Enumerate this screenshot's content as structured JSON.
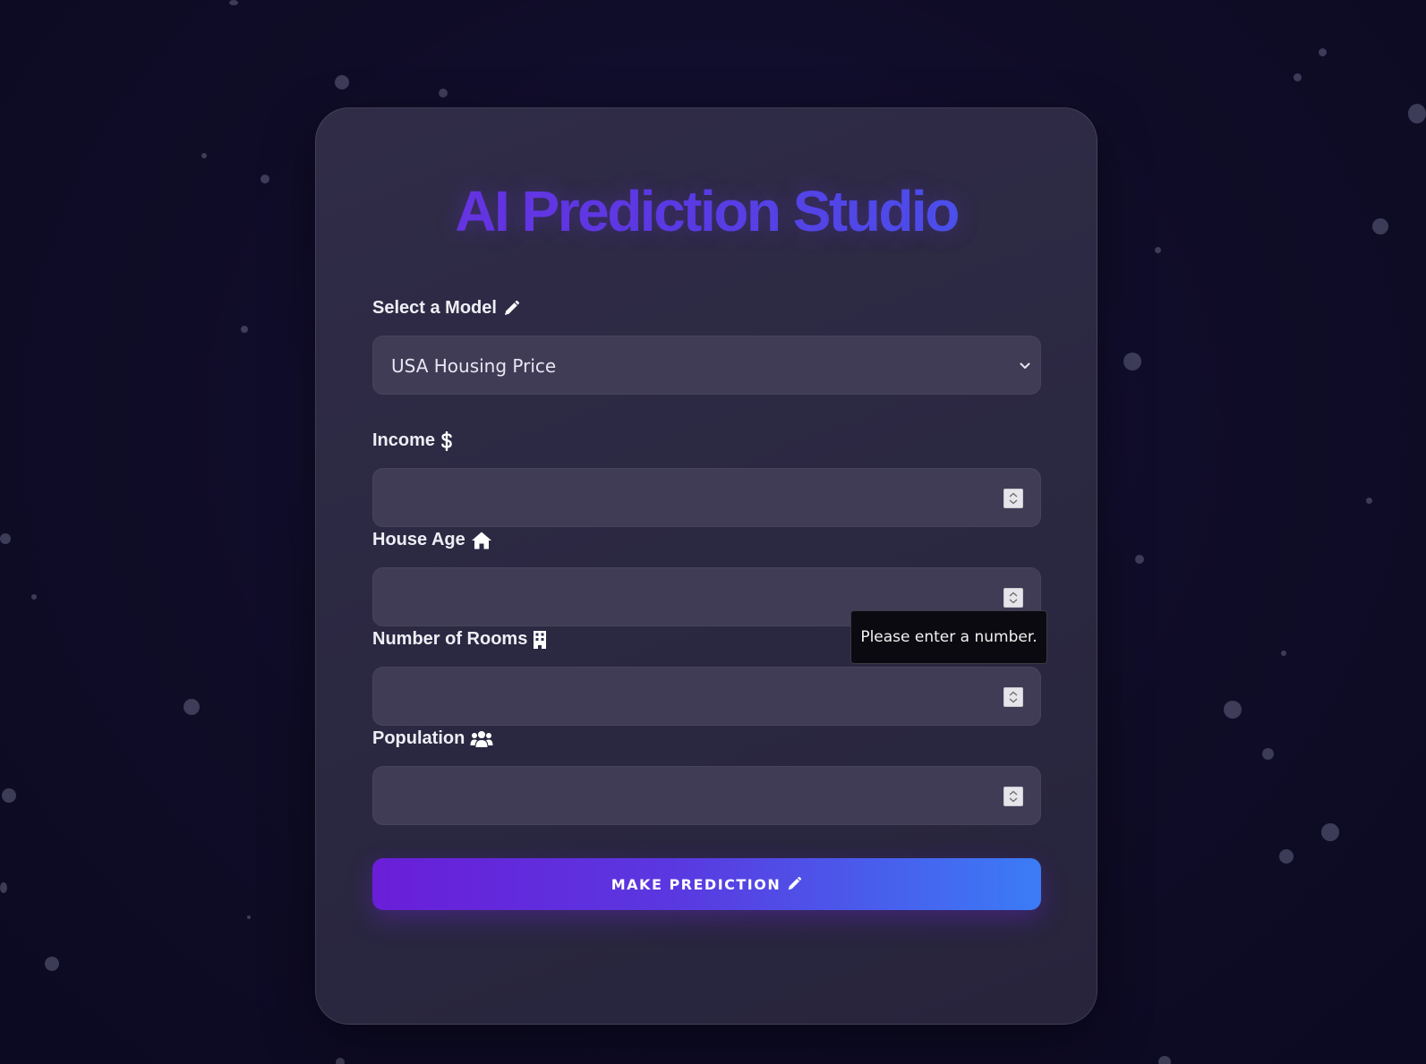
{
  "app": {
    "title": "AI Prediction Studio"
  },
  "form": {
    "model": {
      "label": "Select a Model",
      "selected": "USA Housing Price",
      "icon": "pencil-icon"
    },
    "fields": [
      {
        "label": "Income",
        "value": "",
        "icon": "dollar-icon"
      },
      {
        "label": "House Age",
        "value": "",
        "icon": "home-icon"
      },
      {
        "label": "Number of Rooms",
        "value": "",
        "icon": "building-icon"
      },
      {
        "label": "Population",
        "value": "",
        "icon": "users-icon"
      }
    ],
    "submit": {
      "label": "MAKE PREDICTION",
      "icon": "pencil-icon"
    }
  },
  "tooltip": {
    "text": "Please enter a number."
  },
  "colors": {
    "background": "#100d28",
    "card": "#2d2a44",
    "input": "#413c56",
    "title_start": "#6d2ee0",
    "title_end": "#3f5ef0",
    "button_start": "#6a1ed8",
    "button_end": "#3b7cf6"
  }
}
